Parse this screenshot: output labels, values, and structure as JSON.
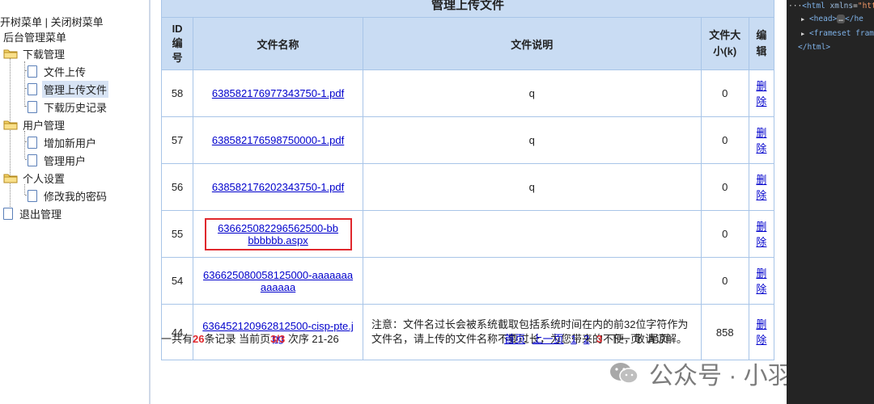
{
  "sidebar": {
    "toggle_open": "开树菜单",
    "separator": "|",
    "toggle_close": "关闭树菜单",
    "root": "后台管理菜单",
    "groups": [
      {
        "label": "下载管理",
        "items": [
          {
            "label": "文件上传"
          },
          {
            "label": "管理上传文件",
            "selected": true
          },
          {
            "label": "下载历史记录"
          }
        ]
      },
      {
        "label": "用户管理",
        "items": [
          {
            "label": "增加新用户"
          },
          {
            "label": "管理用户"
          }
        ]
      },
      {
        "label": "个人设置",
        "items": [
          {
            "label": "修改我的密码"
          }
        ]
      }
    ],
    "logout": "退出管理"
  },
  "table": {
    "caption": "管理上传文件",
    "headers": {
      "id": "ID\n编\n号",
      "name": "文件名称",
      "desc": "文件说明",
      "size": "文件大\n小(k)",
      "edit": "编\n辑"
    },
    "delete_label": "删除",
    "rows": [
      {
        "id": "58",
        "name": "638582176977343750-1.pdf",
        "desc": "q",
        "size": "0"
      },
      {
        "id": "57",
        "name": "638582176598750000-1.pdf",
        "desc": "q",
        "size": "0"
      },
      {
        "id": "56",
        "name": "638582176202343750-1.pdf",
        "desc": "q",
        "size": "0"
      },
      {
        "id": "55",
        "name": "636625082296562500-bbbbbbbb.aspx",
        "desc": "",
        "size": "0",
        "highlighted": true
      },
      {
        "id": "54",
        "name": "636625080058125000-aaaaaaaaaaaaa",
        "desc": "",
        "size": "0"
      },
      {
        "id": "44",
        "name": "636452120962812500-cisp-pte.jpg",
        "desc": "注意：文件名过长会被系统截取包括系统时间在内的前32位字符作为文件名，请上传的文件名称不要过长，为您带来的不便，敬请谅解。",
        "size": "858"
      }
    ]
  },
  "pager": {
    "prefix": "一共有",
    "total": "26",
    "mid1": "条记录 当前页",
    "current": "3/3",
    "mid2": "次序 21-26",
    "first": "首页",
    "prev": "上一页",
    "pages": [
      "1",
      "2",
      "3"
    ],
    "next": "下一页",
    "last": "尾页"
  },
  "watermark": {
    "text": "公众号 · 小羽网安"
  },
  "devtools": {
    "line1_prefix": "···",
    "line1_tag": "<html",
    "line1_attr": "xmlns",
    "line1_val": "\"htt",
    "line2": "<head>",
    "line2_badge": "…",
    "line2_end": "</he",
    "line3": "<frameset fram",
    "line4": "</html>"
  },
  "colors": {
    "accent_blue": "#0000cc",
    "header_bg": "#c9dcf3",
    "border": "#a8c5e8",
    "highlight_red": "#e0282d"
  }
}
